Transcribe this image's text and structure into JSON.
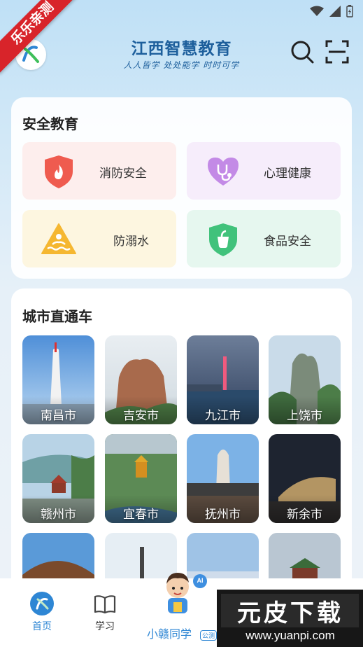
{
  "corner_ribbon": "乐乐亲测",
  "header": {
    "title": "江西智慧教育",
    "slogan": "人人皆学 处处能学 时时可学"
  },
  "safety": {
    "title": "安全教育",
    "items": [
      {
        "label": "消防安全",
        "icon": "fire-shield-icon",
        "color": "#f05a4f"
      },
      {
        "label": "心理健康",
        "icon": "heart-stethoscope-icon",
        "color": "#b57ae0"
      },
      {
        "label": "防溺水",
        "icon": "drowning-warning-icon",
        "color": "#f5b731"
      },
      {
        "label": "食品安全",
        "icon": "food-shield-icon",
        "color": "#3fc07a"
      }
    ]
  },
  "cities": {
    "title": "城市直通车",
    "items": [
      {
        "label": "南昌市"
      },
      {
        "label": "吉安市"
      },
      {
        "label": "九江市"
      },
      {
        "label": "上饶市"
      },
      {
        "label": "赣州市"
      },
      {
        "label": "宜春市"
      },
      {
        "label": "抚州市"
      },
      {
        "label": "新余市"
      },
      {
        "label": ""
      },
      {
        "label": ""
      },
      {
        "label": ""
      },
      {
        "label": ""
      }
    ]
  },
  "nav": {
    "home": "首页",
    "study": "学习",
    "assistant": "小赣同学",
    "assistant_badge": "公测",
    "ai_tag": "AI"
  },
  "watermark": {
    "title": "元皮下载",
    "url": "www.yuanpi.com"
  },
  "colors": {
    "accent": "#2e86d4",
    "title_blue": "#1d5f9c",
    "ribbon": "#d8242a"
  }
}
